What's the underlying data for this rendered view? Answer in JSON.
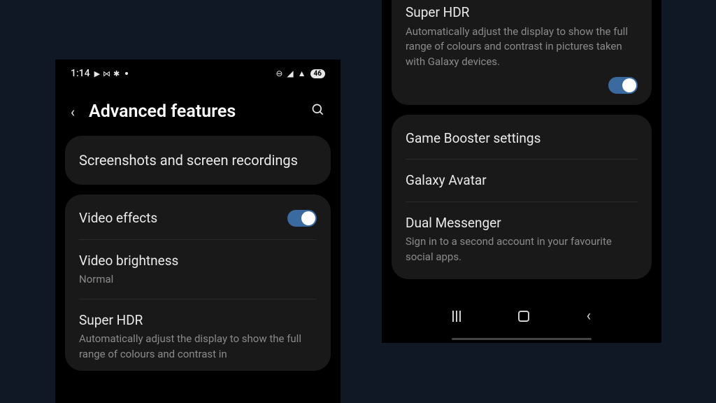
{
  "status": {
    "time": "1:14",
    "battery": "46"
  },
  "header": {
    "title": "Advanced features"
  },
  "left": {
    "screenshots": "Screenshots and screen recordings",
    "video_effects": "Video effects",
    "video_brightness_title": "Video brightness",
    "video_brightness_value": "Normal",
    "super_hdr_title": "Super HDR",
    "super_hdr_desc": "Automatically adjust the display to show the full range of colours and contrast in"
  },
  "right": {
    "super_hdr_title": "Super HDR",
    "super_hdr_desc": "Automatically adjust the display to show the full range of colours and contrast in pictures taken with Galaxy devices.",
    "game_booster": "Game Booster settings",
    "galaxy_avatar": "Galaxy Avatar",
    "dual_messenger_title": "Dual Messenger",
    "dual_messenger_desc": "Sign in to a second account in your favourite social apps."
  }
}
